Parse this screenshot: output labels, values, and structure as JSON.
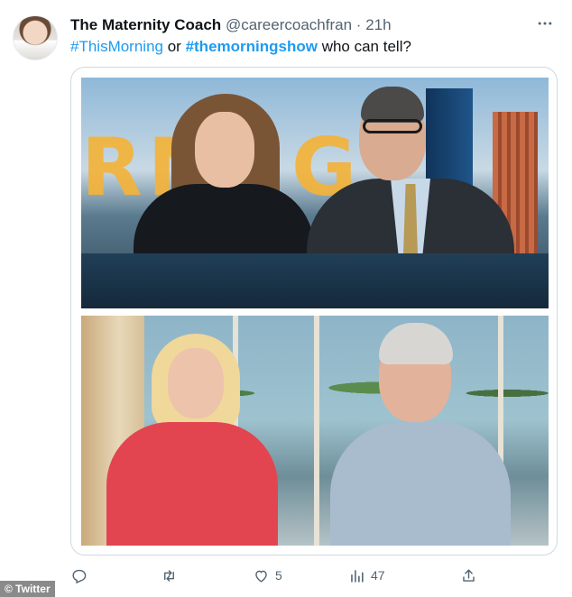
{
  "tweet": {
    "author_name": "The Maternity Coach",
    "handle": "@careercoachfran",
    "separator": "·",
    "time": "21h",
    "text": {
      "tag1": "#ThisMorning",
      "connector": " or ",
      "tag2": "#themorningshow",
      "rest": " who can tell?"
    }
  },
  "media": {
    "top_letters": "RNNG"
  },
  "actions": {
    "reply_count": "",
    "retweet_count": "",
    "like_count": "5",
    "view_count": "47"
  },
  "watermark": "© Twitter",
  "icons": [
    "avatar",
    "more-icon",
    "reply-icon",
    "retweet-icon",
    "like-icon",
    "views-icon",
    "share-icon"
  ],
  "colors": {
    "link": "#1d9bf0",
    "secondary_text": "#536471",
    "primary_text": "#0f1419",
    "border": "#cfd9de"
  }
}
